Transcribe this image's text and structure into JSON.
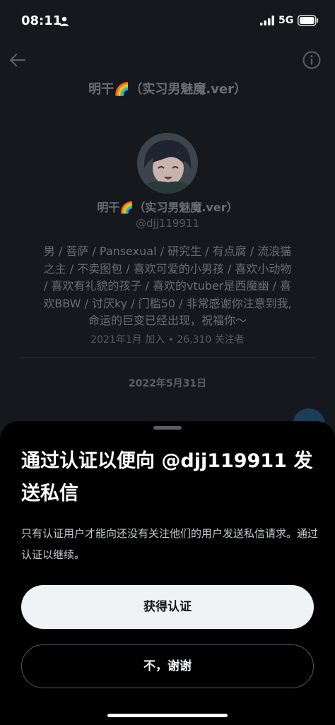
{
  "status_bar": {
    "time": "08:11",
    "network": "5G",
    "icons": [
      "person-icon",
      "signal-icon",
      "battery-icon"
    ]
  },
  "header": {
    "title": "明干🌈（实习男魅魔.ver）",
    "icons": [
      "back-arrow-icon",
      "info-icon"
    ]
  },
  "profile": {
    "display_name": "明干🌈（实习男魅魔.ver）",
    "handle": "@djj119911",
    "bio_lines": [
      "男 / 菩萨 / Pansexual / 研究生 / 有点腐 / 流浪猫",
      "之主 / 不卖图包 / 喜欢可爱的小男孩 / 喜欢小动物",
      " / 喜欢有礼貌的孩子 / 喜欢的vtuber是西魔幽 / 喜",
      "欢BBW / 讨厌ky / 门槛50 / 非常感谢你注意到我,",
      "命运的巨变已经出现，祝福你～"
    ],
    "joined": "2021年1月 加入 • 26,310 关注者"
  },
  "conversation": {
    "date_label": "2022年5月31日"
  },
  "sheet": {
    "title": "通过认证以便向 @djj119911 发送私信",
    "description": "只有认证用户才能向还没有关注他们的用户发送私信请求。通过认证以继续。",
    "primary_label": "获得认证",
    "secondary_label": "不，谢谢"
  },
  "colors": {
    "background": "#15181c",
    "sheet_background": "#000000",
    "primary_button": "#eff3f4",
    "accent_bubble": "#1c3d5a"
  }
}
